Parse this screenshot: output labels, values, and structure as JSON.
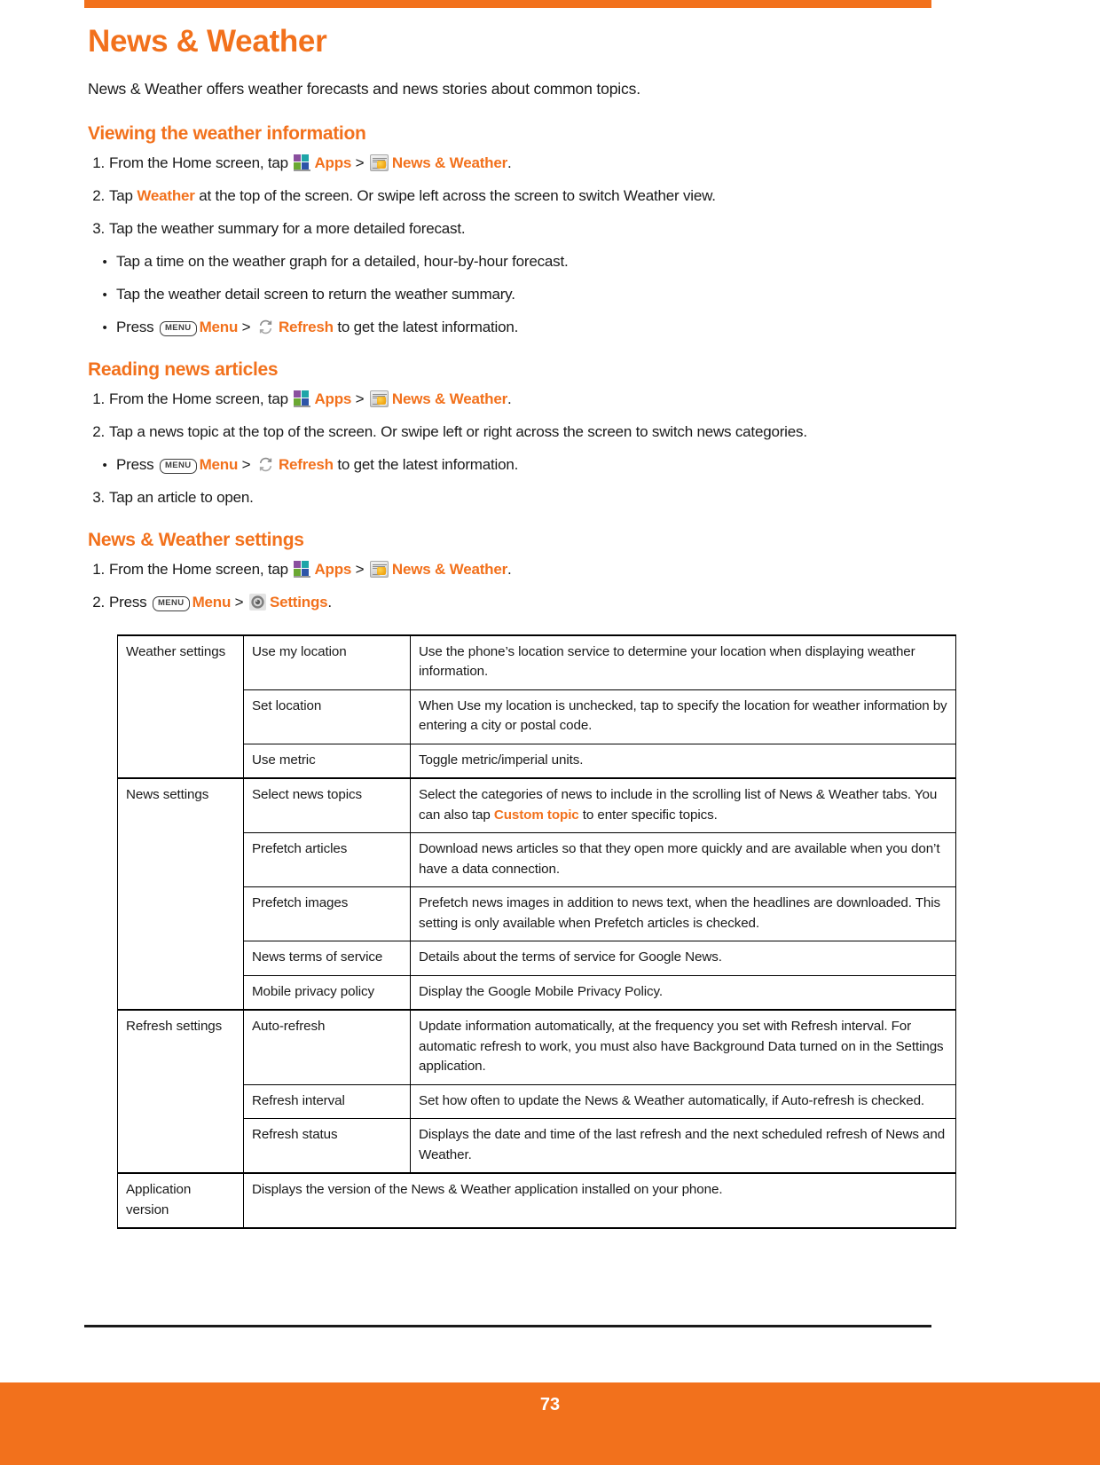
{
  "document": {
    "title": "News & Weather",
    "intro": "News & Weather offers weather forecasts and news stories about common topics.",
    "page_number": "73",
    "accent_color": "#f2711c"
  },
  "icons": {
    "apps": "apps-grid-icon",
    "news_weather": "news-weather-app-icon",
    "menu_key": "MENU",
    "refresh": "refresh-icon",
    "settings": "settings-gear-icon"
  },
  "sections": [
    {
      "heading": "Viewing the weather information",
      "steps": [
        {
          "num": "1.",
          "parts": [
            {
              "t": "text",
              "v": "From the Home screen, tap "
            },
            {
              "t": "icon",
              "v": "apps"
            },
            {
              "t": "hl",
              "v": "Apps"
            },
            {
              "t": "text",
              "v": " > "
            },
            {
              "t": "icon",
              "v": "news_weather"
            },
            {
              "t": "hl",
              "v": "News & Weather"
            },
            {
              "t": "text",
              "v": "."
            }
          ]
        },
        {
          "num": "2.",
          "parts": [
            {
              "t": "text",
              "v": "Tap "
            },
            {
              "t": "hl",
              "v": "Weather"
            },
            {
              "t": "text",
              "v": " at the top of the screen. Or swipe left across the screen to switch Weather view."
            }
          ]
        },
        {
          "num": "3.",
          "parts": [
            {
              "t": "text",
              "v": "Tap the weather summary for a more detailed forecast."
            }
          ]
        },
        {
          "num": "•",
          "indent": true,
          "parts": [
            {
              "t": "text",
              "v": "Tap a time on the weather graph for a detailed, hour-by-hour forecast."
            }
          ]
        },
        {
          "num": "•",
          "indent": true,
          "parts": [
            {
              "t": "text",
              "v": "Tap the weather detail screen to return the weather summary."
            }
          ]
        },
        {
          "num": "•",
          "indent": true,
          "parts": [
            {
              "t": "text",
              "v": "Press "
            },
            {
              "t": "menukey",
              "v": "MENU"
            },
            {
              "t": "hl",
              "v": "Menu"
            },
            {
              "t": "text",
              "v": " > "
            },
            {
              "t": "icon",
              "v": "refresh"
            },
            {
              "t": "hl",
              "v": "Refresh"
            },
            {
              "t": "text",
              "v": " to get the latest information."
            }
          ]
        }
      ]
    },
    {
      "heading": "Reading news articles",
      "steps": [
        {
          "num": "1.",
          "parts": [
            {
              "t": "text",
              "v": "From the Home screen, tap "
            },
            {
              "t": "icon",
              "v": "apps"
            },
            {
              "t": "hl",
              "v": "Apps"
            },
            {
              "t": "text",
              "v": " > "
            },
            {
              "t": "icon",
              "v": "news_weather"
            },
            {
              "t": "hl",
              "v": "News & Weather"
            },
            {
              "t": "text",
              "v": "."
            }
          ]
        },
        {
          "num": "2.",
          "parts": [
            {
              "t": "text",
              "v": "Tap a news topic at the top of the screen. Or swipe left or right across the screen to switch news categories."
            }
          ]
        },
        {
          "num": "•",
          "indent": true,
          "parts": [
            {
              "t": "text",
              "v": "Press "
            },
            {
              "t": "menukey",
              "v": "MENU"
            },
            {
              "t": "hl",
              "v": "Menu"
            },
            {
              "t": "text",
              "v": " > "
            },
            {
              "t": "icon",
              "v": "refresh"
            },
            {
              "t": "hl",
              "v": "Refresh"
            },
            {
              "t": "text",
              "v": " to get the latest information."
            }
          ]
        },
        {
          "num": "3.",
          "parts": [
            {
              "t": "text",
              "v": "Tap an article to open."
            }
          ]
        }
      ]
    },
    {
      "heading": "News & Weather settings",
      "steps": [
        {
          "num": "1.",
          "parts": [
            {
              "t": "text",
              "v": "From the Home screen, tap "
            },
            {
              "t": "icon",
              "v": "apps"
            },
            {
              "t": "hl",
              "v": "Apps"
            },
            {
              "t": "text",
              "v": " > "
            },
            {
              "t": "icon",
              "v": "news_weather"
            },
            {
              "t": "hl",
              "v": "News & Weather"
            },
            {
              "t": "text",
              "v": "."
            }
          ]
        },
        {
          "num": "2.",
          "parts": [
            {
              "t": "text",
              "v": "Press "
            },
            {
              "t": "menukey",
              "v": "MENU"
            },
            {
              "t": "hl",
              "v": "Menu"
            },
            {
              "t": "text",
              "v": " > "
            },
            {
              "t": "icon",
              "v": "settings"
            },
            {
              "t": "hl",
              "v": "Settings"
            },
            {
              "t": "text",
              "v": "."
            }
          ]
        }
      ]
    }
  ],
  "settings_table": {
    "rows": [
      {
        "group": "Weather settings",
        "group_rowspan": 3,
        "group_start": true,
        "setting": "Use my location",
        "parts": [
          {
            "t": "text",
            "v": "Use the phone’s location service to determine your location when displaying weather information."
          }
        ]
      },
      {
        "setting": "Set location",
        "parts": [
          {
            "t": "text",
            "v": "When Use my location is unchecked, tap to specify the location for weather information by entering a city or postal code."
          }
        ]
      },
      {
        "setting": "Use metric",
        "parts": [
          {
            "t": "text",
            "v": "Toggle metric/imperial units."
          }
        ]
      },
      {
        "group": "News settings",
        "group_rowspan": 5,
        "group_start": true,
        "setting": "Select news topics",
        "parts": [
          {
            "t": "text",
            "v": "Select the categories of news to include in the scrolling list of News & Weather tabs. You can also tap "
          },
          {
            "t": "hl",
            "v": "Custom topic"
          },
          {
            "t": "text",
            "v": " to enter specific topics."
          }
        ]
      },
      {
        "setting": "Prefetch articles",
        "parts": [
          {
            "t": "text",
            "v": "Download news articles so that they open more quickly and are available when you don’t have a data connection."
          }
        ]
      },
      {
        "setting": "Prefetch images",
        "parts": [
          {
            "t": "text",
            "v": "Prefetch news images in addition to news text, when the headlines are downloaded. This setting is only available when Prefetch articles is checked."
          }
        ]
      },
      {
        "setting": "News terms of service",
        "parts": [
          {
            "t": "text",
            "v": "Details about the terms of service for Google News."
          }
        ]
      },
      {
        "setting": "Mobile privacy policy",
        "parts": [
          {
            "t": "text",
            "v": "Display the Google Mobile Privacy Policy."
          }
        ]
      },
      {
        "group": "Refresh settings",
        "group_rowspan": 3,
        "group_start": true,
        "setting": "Auto-refresh",
        "parts": [
          {
            "t": "text",
            "v": "Update information automatically, at the frequency you set with Refresh interval. For automatic refresh to work, you must also have Background Data turned on in the Settings application."
          }
        ]
      },
      {
        "setting": "Refresh interval",
        "parts": [
          {
            "t": "text",
            "v": "Set how often to update the News & Weather automatically, if Auto-refresh is checked."
          }
        ]
      },
      {
        "setting": "Refresh status",
        "parts": [
          {
            "t": "text",
            "v": "Displays the date and time of the last refresh and the next scheduled refresh of News and Weather."
          }
        ]
      },
      {
        "group": "Application version",
        "group_rowspan": 1,
        "group_start": true,
        "span_desc": true,
        "parts": [
          {
            "t": "text",
            "v": "Displays the version of the News & Weather application installed on your phone."
          }
        ]
      }
    ]
  }
}
